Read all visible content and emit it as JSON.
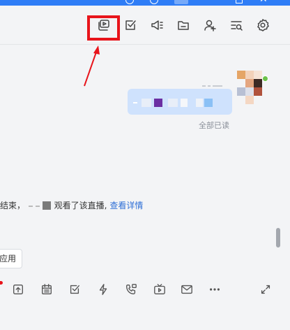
{
  "header": {
    "icons": [
      "live-video-icon",
      "task-check-icon",
      "announcement-icon",
      "folder-icon",
      "add-member-icon",
      "search-history-icon",
      "settings-icon"
    ]
  },
  "chat": {
    "read_status": "全部已读",
    "system_message": {
      "prefix": "结束，",
      "middle": "观看了该直播,",
      "link": "查看详情"
    }
  },
  "apps_button": {
    "label": "应用"
  },
  "toolbar": {
    "icons": [
      "upload-icon",
      "calendar-icon",
      "checkbox-icon",
      "lightning-icon",
      "phone-video-icon",
      "live-tv-icon",
      "mail-icon",
      "more-icon",
      "expand-icon"
    ]
  },
  "colors": {
    "accent": "#2f7df6",
    "highlight": "#e8141b",
    "bubble": "#cfe2fd",
    "link": "#2f6fd6"
  }
}
